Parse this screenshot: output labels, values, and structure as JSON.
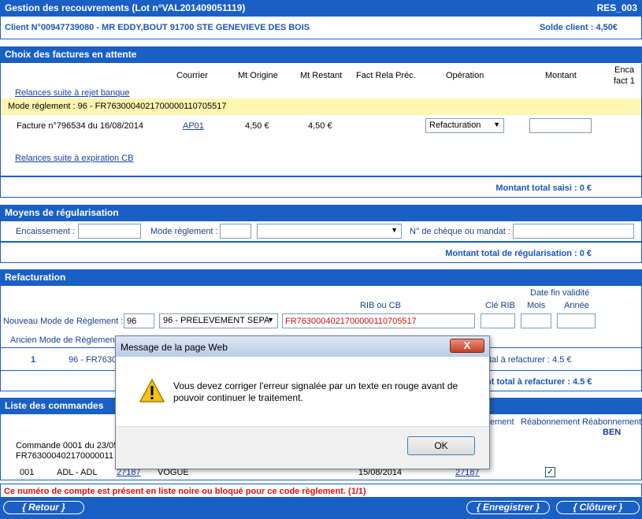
{
  "header": {
    "title": "Gestion des recouvrements (Lot n°VAL201409051119)",
    "code": "RES_003",
    "client": "Client N°00947739080 - MR EDDY,BOUT 91700 STE GENEVIEVE DES BOIS",
    "solde": "Solde client : 4,50€"
  },
  "factures": {
    "title": "Choix des factures en attente",
    "columns": {
      "courrier": "Courrier",
      "mt_origine": "Mt Origine",
      "mt_restant": "Mt Restant",
      "fact_rela": "Fact Rela Préc.",
      "operation": "Opération",
      "montant": "Montant",
      "enca": "Enca",
      "fact1": "fact 1"
    },
    "relances_rejet": "Relances suite à rejet banque",
    "mode_reglement": "Mode règlement : 96 - FR7630004021700000110705517",
    "row": {
      "facture": "Facture n°796534 du 16/08/2014",
      "courrier": "AP01",
      "mt_origine": "4,50 €",
      "mt_restant": "4,50 €",
      "operation": "Refacturation"
    },
    "relances_cb": "Relances suite à expiration CB",
    "total": "Montant total saisi : 0 €"
  },
  "moyens": {
    "title": "Moyens de régularisation",
    "encaissement": "Encaissement :",
    "mode_reglement": "Mode règlement :",
    "cheque": "N° de chèque ou mandat :",
    "total": "Montant total de régularisation : 0 €"
  },
  "refacturation": {
    "title": "Refacturation",
    "rib_label": "RIB ou CB",
    "cle_rib": "Clé RIB",
    "date_fin": "Date fin validité",
    "mois": "Mois",
    "annee": "Année",
    "nouveau_label": "Nouveau Mode de Règlement :",
    "nouveau_code": "96",
    "nouveau_mode": "96 - PRELEVEMENT SEPA",
    "rib_value": "FR7630004021700000110705517",
    "ancien_label": "Ancien Mode de Règlement",
    "row_index": "1",
    "row_mode": "96 - FR7630",
    "total_a_refacturer": "tal à refacturer : 4.5 €",
    "montant_total_refacturer": "nt total à refacturer : 4.5 €"
  },
  "commandes": {
    "title": "Liste des commandes",
    "col_ement": "ement",
    "col_reabonnement": "Réabonnement",
    "col_reabonnement_ben1": "Réabonnement",
    "col_reabonnement_ben2": "BEN",
    "commande": "Commande 0001 du 23/05",
    "commande_rib": "FR763000402170000011",
    "row_num": "001",
    "row_code": "ADL - ADL",
    "row_link": "27187",
    "row_name": "VOGUE",
    "row_date": "15/08/2014",
    "row_link2": "27187",
    "checked": "✓"
  },
  "error": "Ce numéro de compte est présent en liste noire ou bloqué pour ce code règlement. (1/1)",
  "buttons": {
    "retour": "{    Retour    }",
    "enregistrer": "{ Enregistrer }",
    "cloturer": "{  Clôturer  }"
  },
  "dialog": {
    "title": "Message de la page Web",
    "close": "X",
    "message": "Vous devez corriger l'erreur signalée par un texte en rouge avant de pouvoir continuer le traitement.",
    "ok": "OK"
  }
}
